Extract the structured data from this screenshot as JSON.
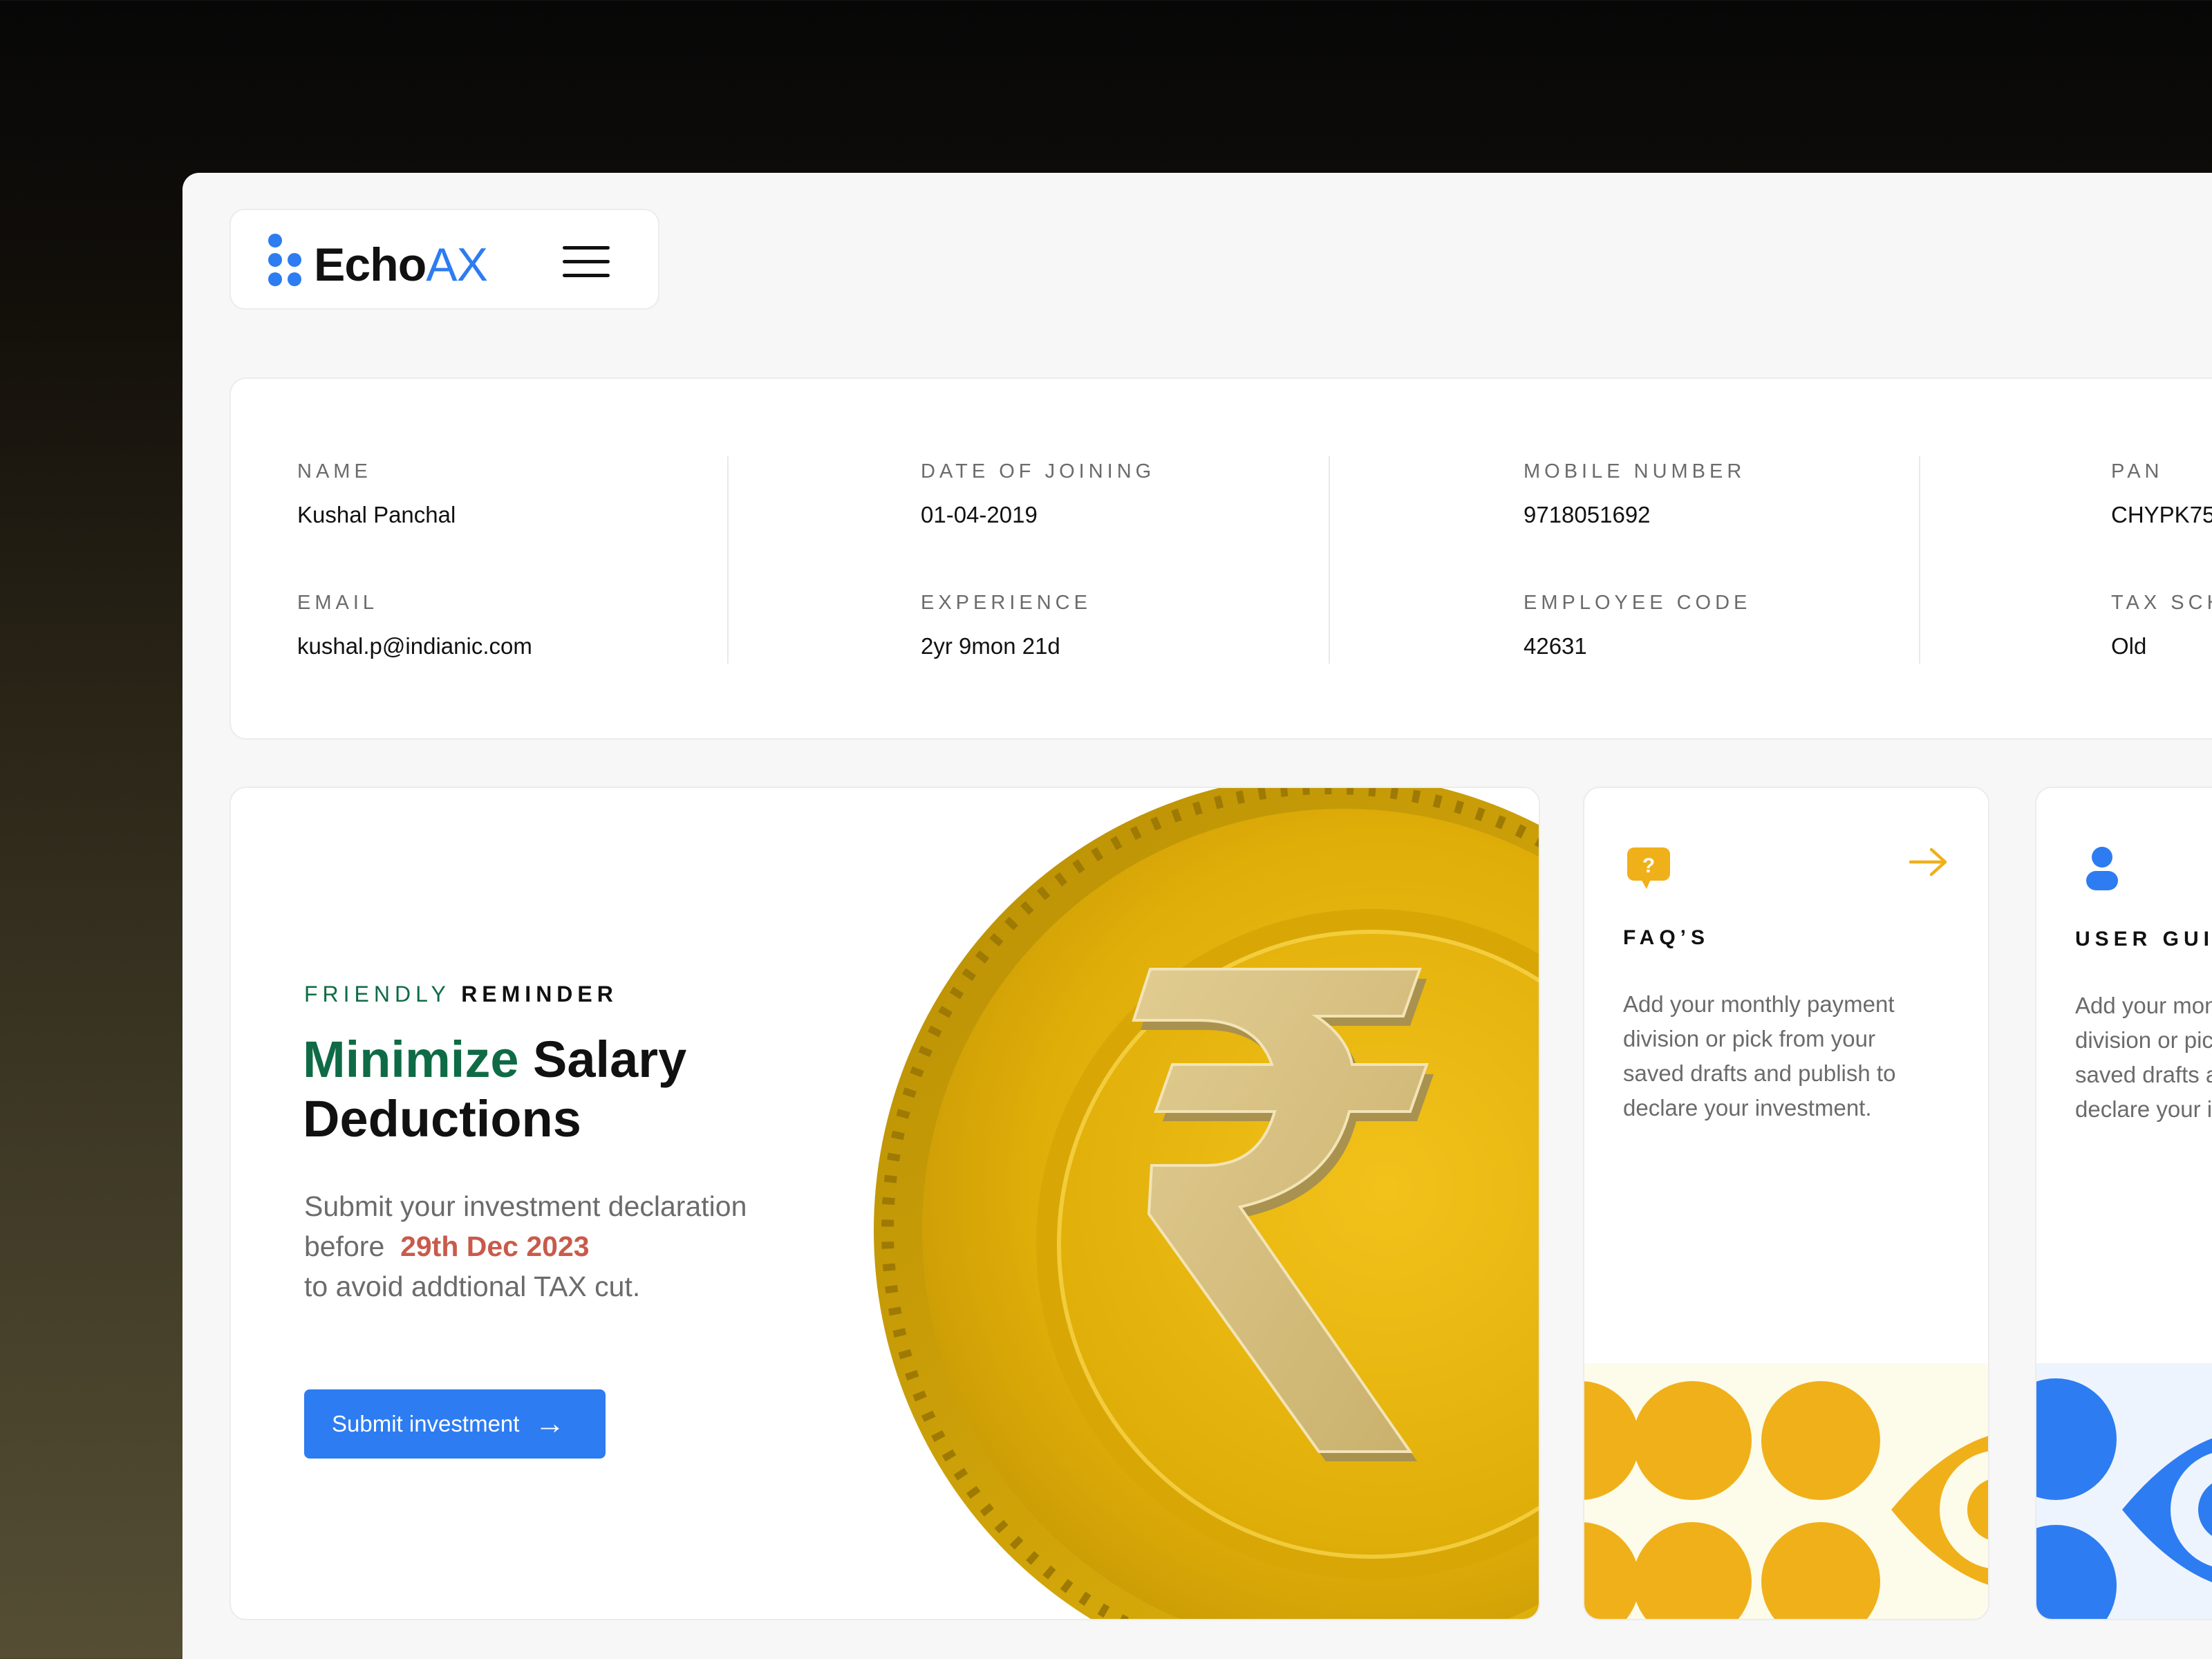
{
  "brand": {
    "name_part1": "Echo",
    "name_part2": "AX",
    "accent": "#2d7cf1"
  },
  "profile": {
    "name_label": "NAME",
    "name_value": "Kushal Panchal",
    "email_label": "EMAIL",
    "email_value": "kushal.p@indianic.com",
    "doj_label": "DATE OF JOINING",
    "doj_value": "01-04-2019",
    "experience_label": "EXPERIENCE",
    "experience_value": "2yr 9mon 21d",
    "mobile_label": "MOBILE NUMBER",
    "mobile_value": "9718051692",
    "empcode_label": "EMPLOYEE CODE",
    "empcode_value": "42631",
    "pan_label": "PAN",
    "pan_value": "CHYPK75",
    "tax_label": "TAX SCH",
    "tax_value": "Old"
  },
  "hero": {
    "reminder_part1": "FRIENDLY",
    "reminder_part2": "REMINDER",
    "headline_part1": "Minimize",
    "headline_part2": "Salary Deductions",
    "subtext_line1": "Submit your investment declaration",
    "subtext_before": "before",
    "subtext_date": "29th Dec 2023",
    "subtext_line3": "to avoid addtional TAX cut.",
    "button_label": "Submit investment",
    "button_arrow": "→",
    "coin_symbol": "₹"
  },
  "faq_card": {
    "icon": "question-chat-icon",
    "title": "FAQ’S",
    "description": "Add your monthly payment division or pick from your saved drafts and publish to declare your investment.",
    "accent": "#f0b01a"
  },
  "guide_card": {
    "icon": "user-icon",
    "title": "USER GUIDE",
    "description": "Add your monthly payment division or pick from your saved drafts and publish to declare your investment.",
    "accent": "#2d7cf1"
  },
  "colors": {
    "green": "#0f6b45",
    "date_red": "#c95a4b",
    "coin_gold": "#e3b50c",
    "symbol_tan": "#d3bd80"
  }
}
